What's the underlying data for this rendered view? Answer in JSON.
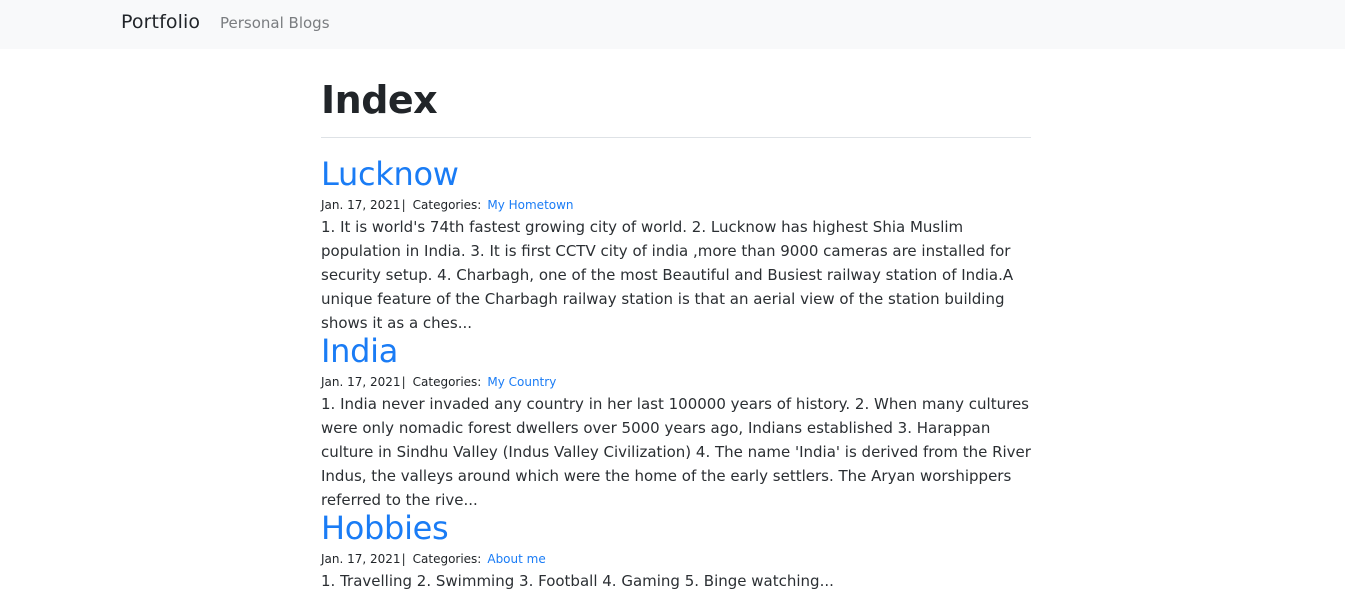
{
  "navbar": {
    "brand": "Portfolio",
    "links": [
      "Personal Blogs"
    ]
  },
  "page": {
    "title": "Index"
  },
  "posts": [
    {
      "title": "Lucknow",
      "date": "Jan. 17, 2021",
      "separator": "|",
      "categories_label": "Categories:",
      "category": "My Hometown",
      "excerpt": "1. It is world's 74th fastest growing city of world. 2. Lucknow has highest Shia Muslim population in India. 3. It is first CCTV city of india ,more than 9000 cameras are installed for security setup. 4. Charbagh, one of the most Beautiful and Busiest railway station of India.A unique feature of the Charbagh railway station is that an aerial view of the station building shows it as a ches..."
    },
    {
      "title": "India",
      "date": "Jan. 17, 2021",
      "separator": "|",
      "categories_label": "Categories:",
      "category": "My Country",
      "excerpt": "1. India never invaded any country in her last 100000 years of history. 2. When many cultures were only nomadic forest dwellers over 5000 years ago, Indians established 3. Harappan culture in Sindhu Valley (Indus Valley Civilization) 4. The name 'India' is derived from the River Indus, the valleys around which were the home of the early settlers. The Aryan worshippers referred to the rive..."
    },
    {
      "title": "Hobbies",
      "date": "Jan. 17, 2021",
      "separator": "|",
      "categories_label": "Categories:",
      "category": "About me",
      "excerpt": "1. Travelling 2. Swimming 3. Football 4. Gaming 5. Binge watching..."
    }
  ],
  "colors": {
    "navbar_bg": "#f8f9fa",
    "link": "#1a7cf5",
    "text": "#212529",
    "muted_nav": "#7a7d80",
    "divider": "#dee2e6"
  }
}
